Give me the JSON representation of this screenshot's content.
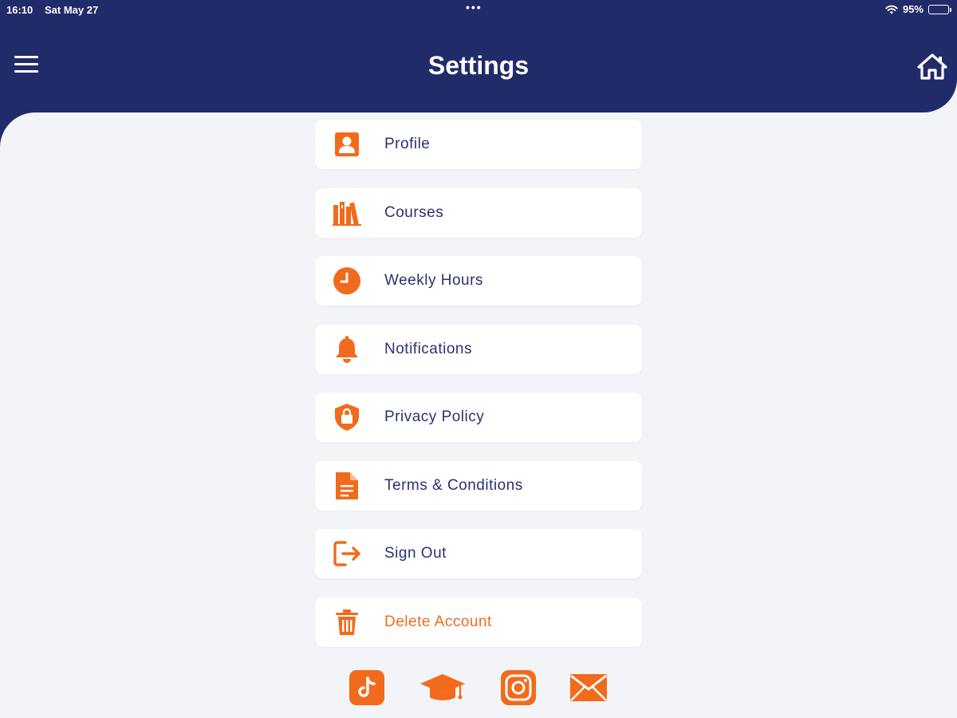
{
  "status_bar": {
    "time": "16:10",
    "date": "Sat May 27",
    "battery": "95%",
    "battery_level": 0.95
  },
  "header": {
    "title": "Settings",
    "menu_icon": "hamburger-icon",
    "home_icon": "home-icon"
  },
  "colors": {
    "header_bg": "#222b6a",
    "accent": "#f26a1b",
    "text": "#2b3170",
    "background": "#f3f4f8"
  },
  "settings_items": [
    {
      "label": "Profile",
      "icon": "profile-icon"
    },
    {
      "label": "Courses",
      "icon": "books-icon"
    },
    {
      "label": "Weekly Hours",
      "icon": "clock-icon"
    },
    {
      "label": "Notifications",
      "icon": "bell-icon"
    },
    {
      "label": "Privacy Policy",
      "icon": "shield-lock-icon"
    },
    {
      "label": "Terms & Conditions",
      "icon": "document-icon"
    },
    {
      "label": "Sign Out",
      "icon": "sign-out-icon"
    },
    {
      "label": "Delete Account",
      "icon": "trash-icon"
    }
  ],
  "social_links": [
    {
      "icon": "tiktok-icon"
    },
    {
      "icon": "graduation-cap-icon"
    },
    {
      "icon": "instagram-icon"
    },
    {
      "icon": "email-icon"
    }
  ]
}
